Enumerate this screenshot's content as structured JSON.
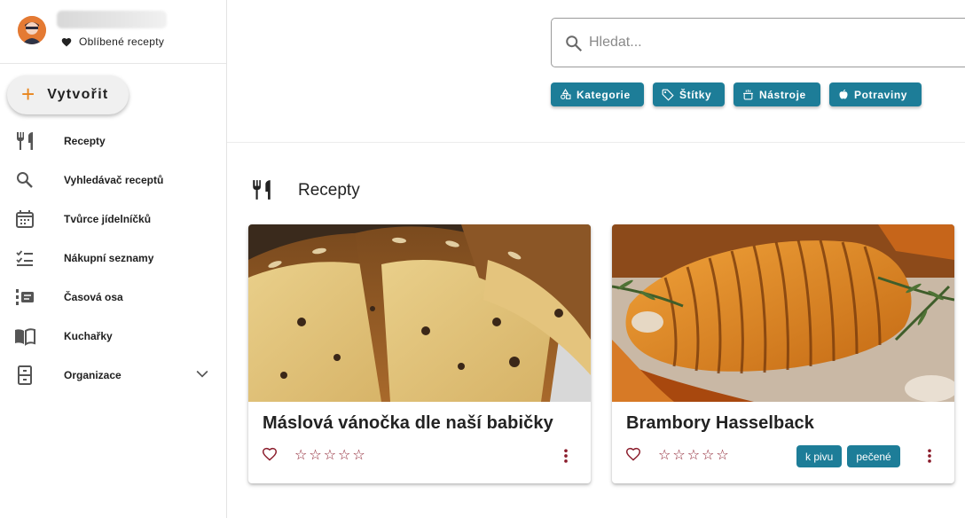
{
  "sidebar": {
    "user": {
      "favorites_label": "Oblíbené recepty"
    },
    "create_label": "Vytvořit",
    "nav": [
      {
        "label": "Recepty",
        "icon": "fork-knife-icon"
      },
      {
        "label": "Vyhledávač receptů",
        "icon": "search-icon"
      },
      {
        "label": "Tvůrce jídelníčků",
        "icon": "calendar-icon"
      },
      {
        "label": "Nákupní seznamy",
        "icon": "checklist-icon"
      },
      {
        "label": "Časová osa",
        "icon": "timeline-icon"
      },
      {
        "label": "Kuchařky",
        "icon": "book-icon"
      },
      {
        "label": "Organizace",
        "icon": "cabinet-icon"
      }
    ]
  },
  "search": {
    "placeholder": "Hledat..."
  },
  "filters": [
    {
      "label": "Kategorie",
      "icon": "shapes-icon"
    },
    {
      "label": "Štítky",
      "icon": "tag-icon"
    },
    {
      "label": "Nástroje",
      "icon": "pot-icon"
    },
    {
      "label": "Potraviny",
      "icon": "apple-icon"
    }
  ],
  "main": {
    "section_title": "Recepty",
    "recipes": [
      {
        "title": "Máslová vánočka dle naší babičky",
        "rating": "☆☆☆☆☆",
        "tags": []
      },
      {
        "title": "Brambory Hasselback",
        "rating": "☆☆☆☆☆",
        "tags": [
          "k pivu",
          "pečené"
        ]
      }
    ]
  },
  "colors": {
    "accent": "#1d7d98",
    "create_plus": "#e8851d",
    "rating": "#8b1d2c"
  }
}
